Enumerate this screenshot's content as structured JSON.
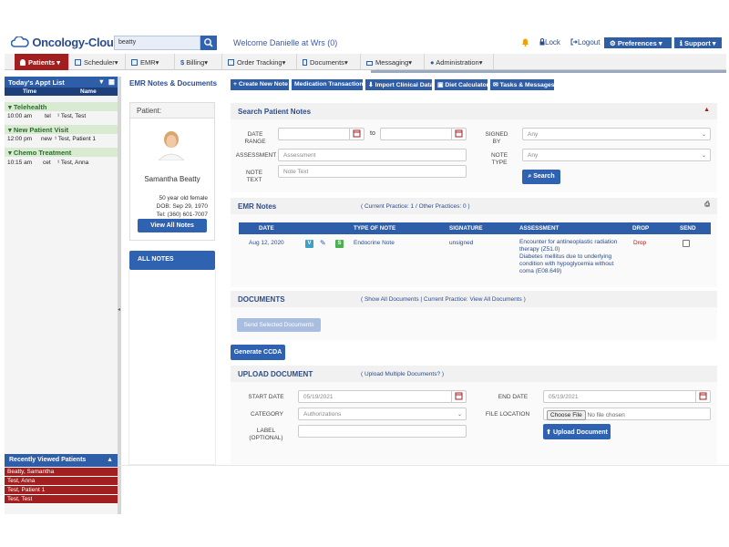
{
  "app": {
    "logo_text": "Oncology-Cloud",
    "search_value": "beatty",
    "welcome": "Welcome Danielle at Wrs (0)",
    "lock": "Lock",
    "logout": "Logout",
    "preferences": "Preferences",
    "support": "Support"
  },
  "nav": [
    {
      "label": "Patients"
    },
    {
      "label": "Scheduler"
    },
    {
      "label": "EMR"
    },
    {
      "label": "Billing"
    },
    {
      "label": "Order Tracking"
    },
    {
      "label": "Documents"
    },
    {
      "label": "Messaging"
    },
    {
      "label": "Administration"
    }
  ],
  "sidebar": {
    "title": "Today's Appt List",
    "col_time": "Time",
    "col_name": "Name",
    "groups": [
      {
        "name": "Telehealth",
        "rows": [
          {
            "time": "10:00 am",
            "type": "tel",
            "name": "Test, Test"
          }
        ]
      },
      {
        "name": "New Patient Visit",
        "rows": [
          {
            "time": "12:00 pm",
            "type": "new",
            "name": "Test, Patient 1"
          }
        ]
      },
      {
        "name": "Chemo Treatment",
        "rows": [
          {
            "time": "10:15 am",
            "type": "cet",
            "name": "Test, Anna"
          }
        ]
      }
    ],
    "recent_title": "Recently Viewed Patients",
    "recent": [
      "Beatty, Samantha",
      "Test, Anna",
      "Test, Patient 1",
      "Test, Test"
    ]
  },
  "patient": {
    "page_title": "EMR Notes & Documents",
    "label": "Patient:",
    "name": "Samantha Beatty",
    "age_sex": "50 year old female",
    "dob": "DOB: Sep 29, 1970",
    "tel": "Tel: (360) 601-7007",
    "view_all": "View All Notes",
    "all_notes": "ALL NOTES"
  },
  "toolbar": [
    "Create New Note",
    "Medication Transactions",
    "Import Clinical Data",
    "Diet Calculator",
    "Tasks & Messages"
  ],
  "search": {
    "title": "Search Patient Notes",
    "date_range": "DATE RANGE",
    "to": "to",
    "signed_by": "SIGNED BY",
    "signed_by_value": "Any",
    "assessment": "ASSESSMENT",
    "assessment_ph": "Assessment",
    "note_type": "NOTE TYPE",
    "note_type_value": "Any",
    "note_text": "NOTE TEXT",
    "note_text_ph": "Note Text",
    "search_btn": "Search"
  },
  "emr": {
    "title": "EMR Notes",
    "meta": "( Current Practice: 1 / Other Practices: 0 )",
    "columns": [
      "DATE",
      "TYPE OF NOTE",
      "SIGNATURE",
      "ASSESSMENT",
      "DROP",
      "SEND"
    ],
    "row": {
      "date": "Aug 12, 2020",
      "type": "Endocrine Note",
      "signature": "unsigned",
      "assessment1": "Encounter for antineoplastic radiation therapy (Z51.0)",
      "assessment2": "Diabetes mellitus due to underlying condition with hypoglycemia without coma (E08.649)",
      "drop": "Drop"
    }
  },
  "documents": {
    "title": "DOCUMENTS",
    "meta": "( Show All Documents | Current Practice: View All Documents )",
    "send_btn": "Send Selected Documents",
    "ccda_btn": "Generate CCDA"
  },
  "upload": {
    "title": "UPLOAD DOCUMENT",
    "meta": "( Upload Multiple Documents? )",
    "start_date": "START DATE",
    "start_value": "05/19/2021",
    "end_date": "END DATE",
    "end_value": "05/19/2021",
    "category": "CATEGORY",
    "category_value": "Authorizations",
    "file_location": "FILE LOCATION",
    "choose": "Choose File",
    "no_file": "No file chosen",
    "label": "LABEL (OPTIONAL)",
    "upload_btn": "Upload Document"
  },
  "colors": {
    "brand_blue": "#2f5ea8",
    "brand_red": "#a31f1f",
    "group_green": "#d8ead2"
  }
}
